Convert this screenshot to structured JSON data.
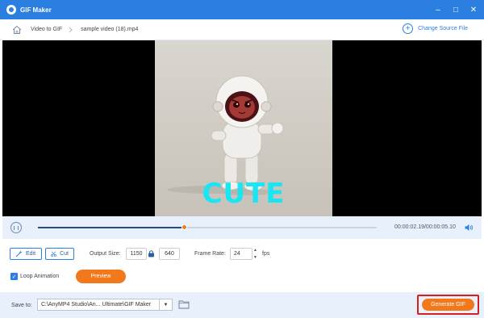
{
  "window": {
    "title": "GIF Maker",
    "controls": [
      "minimize",
      "maximize",
      "close"
    ]
  },
  "breadcrumb": {
    "items": [
      "Video to GIF",
      "sample video (18).mp4"
    ],
    "action": "Change Source File"
  },
  "preview": {
    "caption": "CUTE"
  },
  "player": {
    "time": "00:00:02.19/00:00:05.10",
    "progress": 0.43
  },
  "settings": {
    "edit_label": "Edit",
    "cut_label": "Cut",
    "output_size_label": "Output Size:",
    "width": "1150",
    "height": "640",
    "frame_rate_label": "Frame Rate:",
    "frame_rate": "24",
    "fps_label": "fps",
    "loop_label": "Loop Animation",
    "loop_checked": true,
    "preview_label": "Preview"
  },
  "footer": {
    "save_to_label": "Save to:",
    "path": "C:\\AnyMP4 Studio\\An... Ultimate\\GIF Maker",
    "generate_label": "Generate GIF"
  },
  "colors": {
    "accent": "#2b7fe0",
    "orange": "#f2781c",
    "caption": "#19e6f2",
    "highlight": "#d81f1f"
  }
}
